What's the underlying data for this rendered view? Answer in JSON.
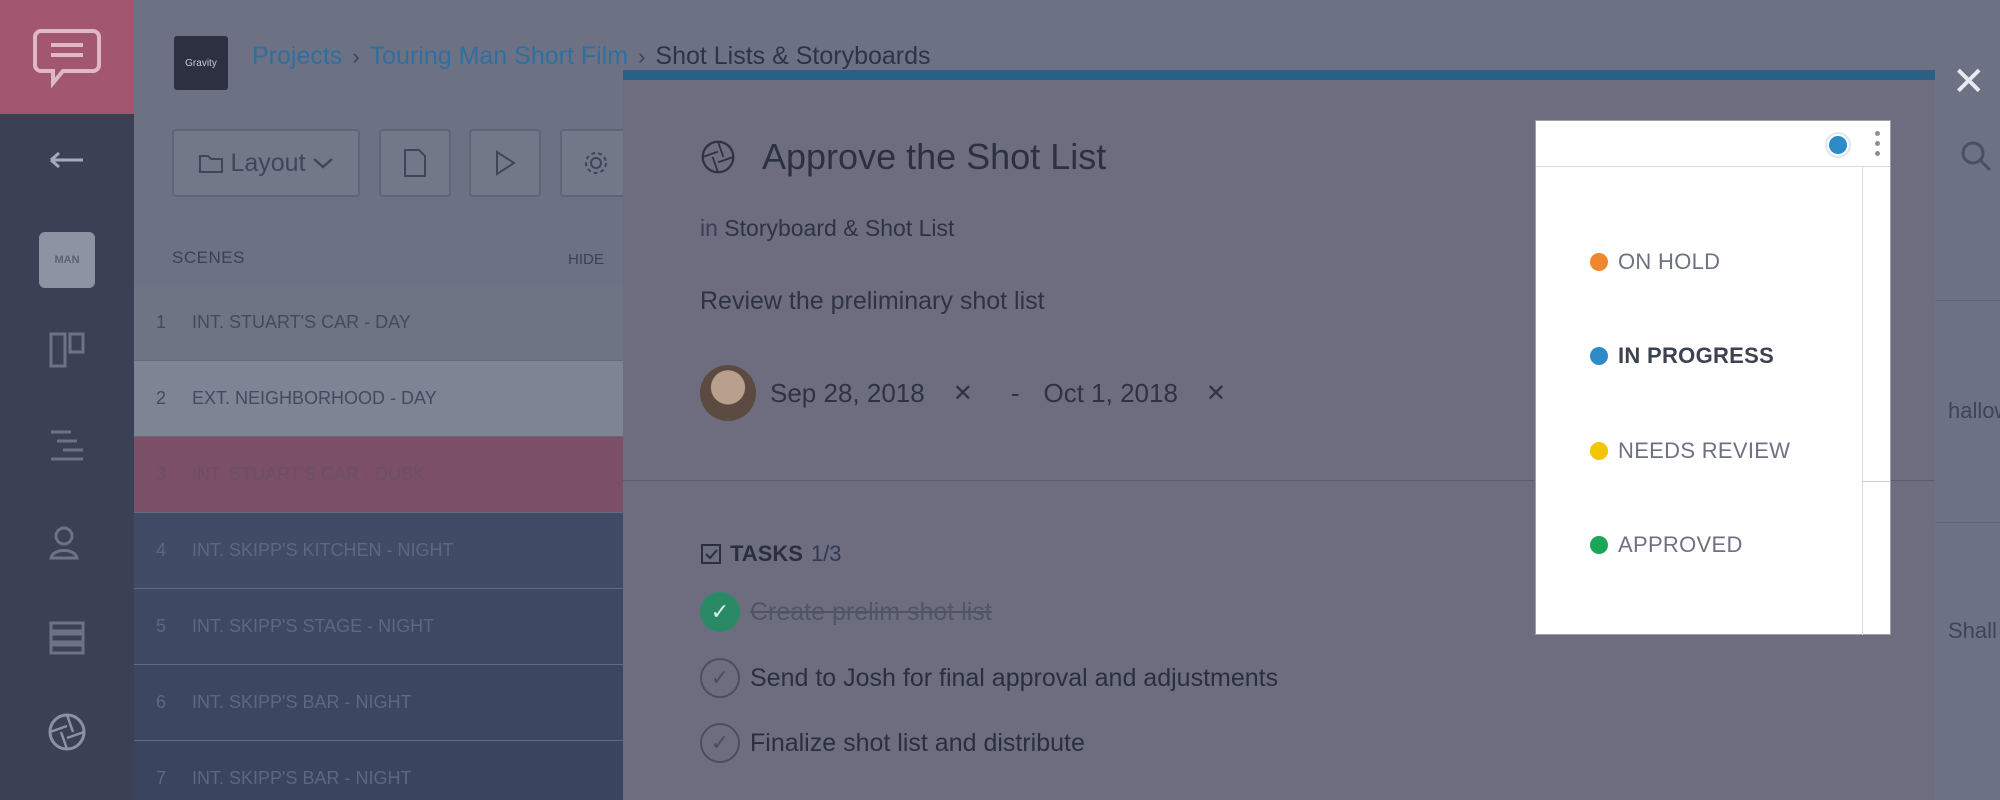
{
  "breadcrumb": {
    "logo_text": "Gravity",
    "projects": "Projects",
    "project": "Touring Man Short Film",
    "page": "Shot Lists & Storyboards"
  },
  "toolbar": {
    "layout_label": "Layout"
  },
  "rail": {
    "project_thumb_text": "MAN"
  },
  "scenes": {
    "header": "SCENES",
    "hide_label": "HIDE",
    "rows": [
      {
        "num": "1",
        "name": "INT. STUART'S CAR - DAY"
      },
      {
        "num": "2",
        "name": "EXT. NEIGHBORHOOD - DAY"
      },
      {
        "num": "3",
        "name": "INT. STUART'S CAR - DUSK"
      },
      {
        "num": "4",
        "name": "INT. SKIPP'S KITCHEN - NIGHT"
      },
      {
        "num": "5",
        "name": "INT. SKIPP'S STAGE - NIGHT"
      },
      {
        "num": "6",
        "name": "INT. SKIPP'S BAR - NIGHT"
      },
      {
        "num": "7",
        "name": "INT. SKIPP'S BAR - NIGHT"
      }
    ]
  },
  "right_fragments": {
    "a": "hallow",
    "b": "Shall"
  },
  "modal": {
    "title": "Approve the Shot List",
    "in_prefix": "in",
    "parent": "Storyboard & Shot List",
    "description": "Review the preliminary shot list",
    "start_date": "Sep 28, 2018",
    "date_separator": "-",
    "end_date": "Oct 1, 2018",
    "tasks_label": "TASKS",
    "tasks_count": "1/3",
    "tasks": [
      {
        "text": "Create prelim shot list",
        "done": true
      },
      {
        "text": "Send to Josh for final approval and adjustments",
        "done": false
      },
      {
        "text": "Finalize shot list and distribute",
        "done": false
      }
    ]
  },
  "status_dropdown": {
    "selected_color": "#2d8cc7",
    "options": [
      {
        "label": "ON HOLD",
        "color": "#f0862e"
      },
      {
        "label": "IN PROGRESS",
        "color": "#2d8cc7"
      },
      {
        "label": "NEEDS REVIEW",
        "color": "#f2c500"
      },
      {
        "label": "APPROVED",
        "color": "#1aa557"
      }
    ],
    "active": "IN PROGRESS"
  },
  "colors": {
    "rail_bg": "#3b4155",
    "rail_logo_bg": "#a3566f",
    "highlight_row": "#9a5a72",
    "modal_accent": "#2a5f86"
  }
}
